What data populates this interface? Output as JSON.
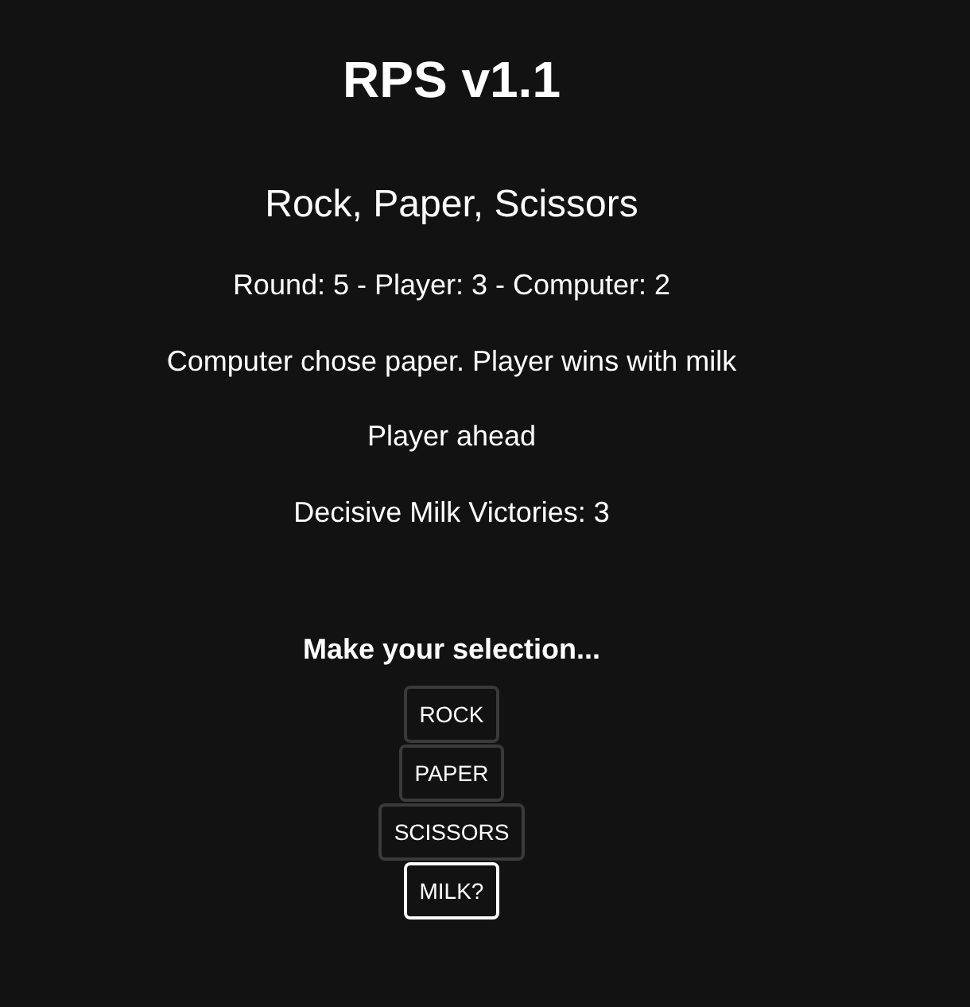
{
  "title": "RPS v1.1",
  "subtitle": "Rock, Paper, Scissors",
  "status_lines": [
    "Round: 5 - Player: 3 - Computer: 2",
    "Computer chose paper. Player wins with milk",
    "Player ahead",
    "Decisive Milk Victories: 3"
  ],
  "prompt": "Make your selection...",
  "buttons": [
    {
      "label": "ROCK",
      "selected": false
    },
    {
      "label": "PAPER",
      "selected": false
    },
    {
      "label": "SCISSORS",
      "selected": false
    },
    {
      "label": "MILK?",
      "selected": true
    }
  ]
}
